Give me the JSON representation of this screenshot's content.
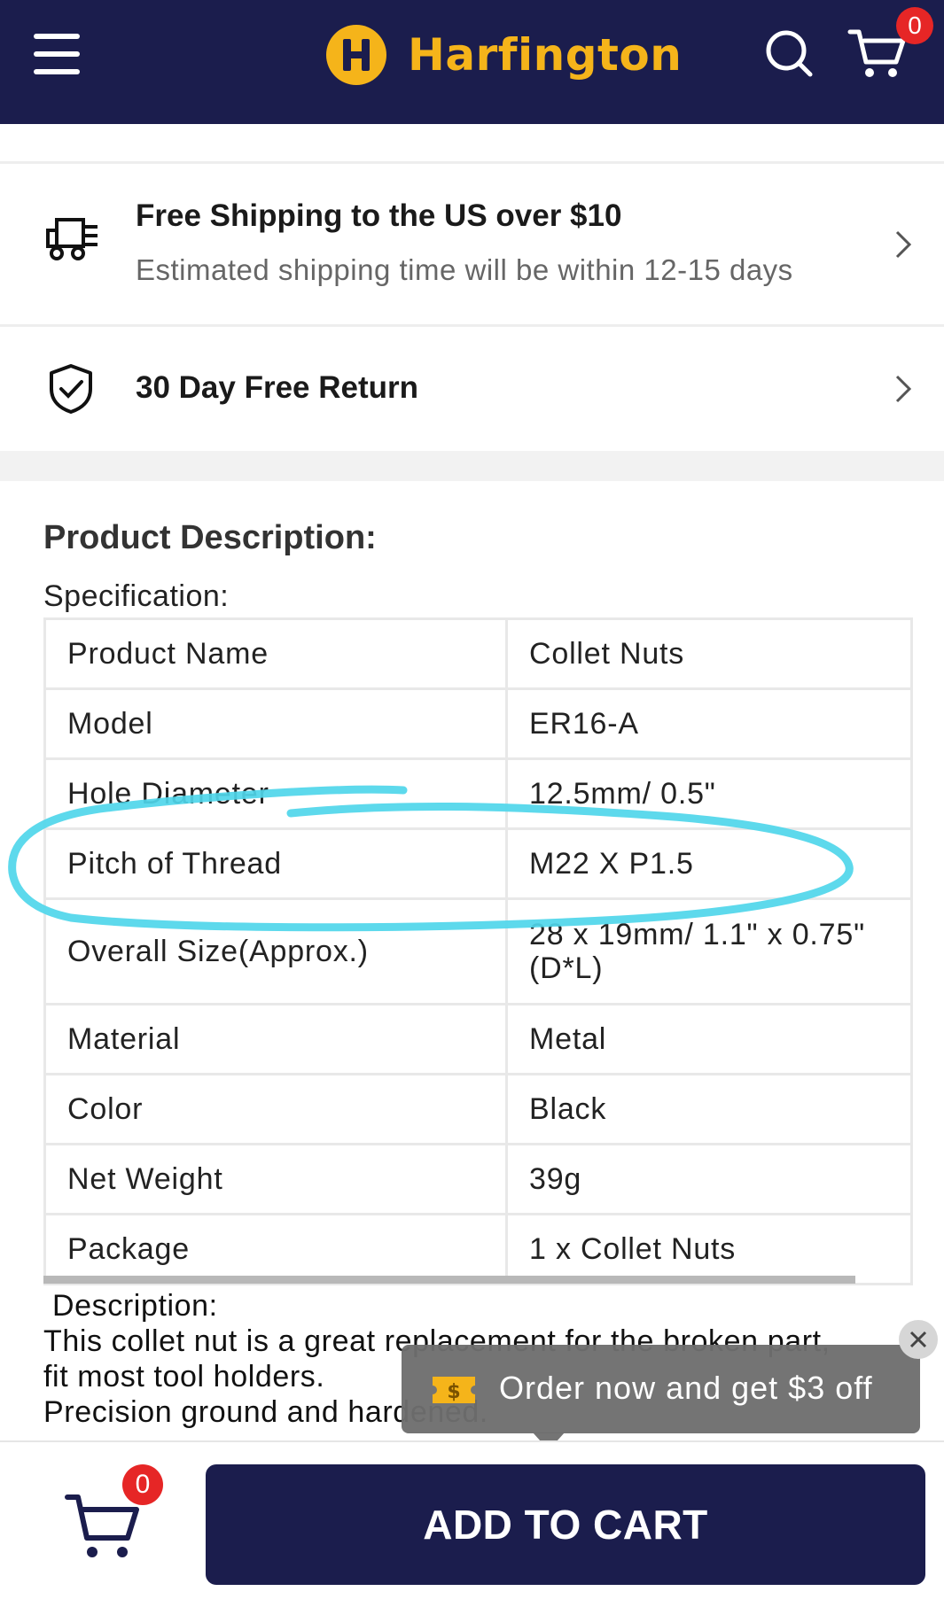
{
  "header": {
    "brand": "Harfington",
    "cart_count": "0"
  },
  "shipping": {
    "title": "Free Shipping to the US over $10",
    "subtitle": "Estimated shipping time will be within 12-15 days"
  },
  "returns": {
    "title": "30 Day Free Return"
  },
  "description": {
    "heading": "Product Description:",
    "spec_label": "Specification:",
    "specs": [
      {
        "key": "Product Name",
        "value": "Collet Nuts"
      },
      {
        "key": "Model",
        "value": "ER16-A"
      },
      {
        "key": "Hole Diameter",
        "value": "12.5mm/ 0.5\""
      },
      {
        "key": "Pitch of Thread",
        "value": "M22 X P1.5"
      },
      {
        "key": "Overall Size(Approx.)",
        "value": "28 x 19mm/ 1.1\" x 0.75\" (D*L)"
      },
      {
        "key": "Material",
        "value": "Metal"
      },
      {
        "key": "Color",
        "value": "Black"
      },
      {
        "key": "Net Weight",
        "value": "39g"
      },
      {
        "key": "Package",
        "value": "1 x Collet Nuts"
      }
    ],
    "text_lines": [
      "Description:",
      "This collet nut is a great replacement for the broken part,",
      "fit most tool holders.",
      "Precision ground and hardened."
    ]
  },
  "toast": {
    "coupon_symbol": "$",
    "text": "Order now and get $3 off"
  },
  "bottom": {
    "cart_count": "0",
    "add_to_cart": "ADD TO CART"
  },
  "colors": {
    "navy": "#1b1d4d",
    "brand_yellow": "#f5b41a",
    "badge_red": "#e62626",
    "highlight_cyan": "#4fd6ea"
  }
}
